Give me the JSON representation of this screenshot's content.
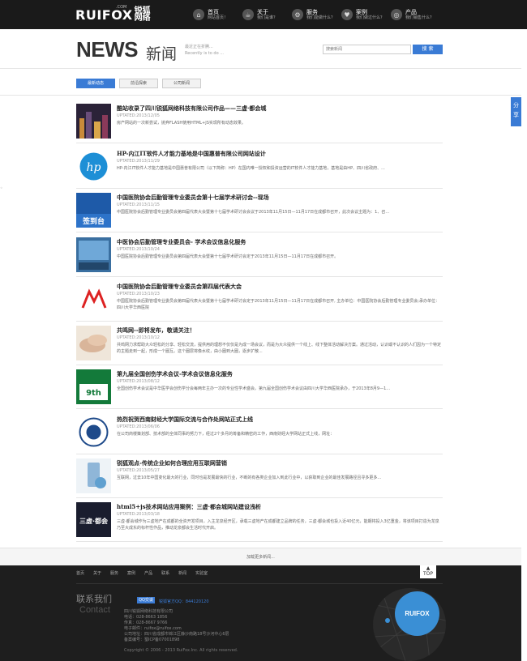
{
  "header": {
    "logo_text": "RUIFOX",
    "logo_com": ".COM",
    "logo_cn": "锐狐网络",
    "nav": [
      {
        "title": "首页",
        "sub": "网站首页！",
        "icon": "home-icon"
      },
      {
        "title": "关于",
        "sub": "我们是谁？",
        "icon": "coffee-icon"
      },
      {
        "title": "服务",
        "sub": "我们能做什么？",
        "icon": "gear-icon"
      },
      {
        "title": "案例",
        "sub": "我们做过什么？",
        "icon": "heart-icon"
      },
      {
        "title": "产品",
        "sub": "我们销售什么？",
        "icon": "settings-icon"
      }
    ]
  },
  "page": {
    "title_en": "NEWS",
    "title_cn": "新闻",
    "sub_line1": "最近正在折腾...",
    "sub_line2": "Recently is to do ...",
    "search_placeholder": "搜索新闻",
    "search_button": "搜 索"
  },
  "tabs": [
    {
      "label": "最新动态",
      "active": true
    },
    {
      "label": "前沿探索",
      "active": false
    },
    {
      "label": "公司新闻",
      "active": false
    }
  ],
  "share_label": "分享",
  "news": [
    {
      "title": "酷站收录了四川锐狐网络科技有限公司作品——三虚·都会城",
      "date": "UPTATED:2013/12/05",
      "desc": "房产网站的一次新尝试，抛弃FLASH使用HTML+JS实现所有动态效果。",
      "thumb": "city"
    },
    {
      "title": "HP-内江IT软件人才能力基地是中国惠普有限公司网站设计",
      "date": "UPTATED:2013/11/29",
      "desc": "HP-内江IT软件人才能力基地是中国惠普有限公司（以下简称：HP）在国内唯一授权和投资运营的IT软件人才能力基地，基地是由HP、四川省政府、...",
      "thumb": "hp"
    },
    {
      "title": "中国医院协会后勤管理专业委员会第十七届学术研讨会--现场",
      "date": "UPTATED:2013/11/15",
      "desc": "中国医院协会后勤管理专业委员会第四届代表大会暨第十七届学术研讨会会议于2013年11月15日—11月17日在成都市召开，此次会议主题为：1、召...",
      "thumb": "sign"
    },
    {
      "title": "中医协会后勤管理专业委员会- 学术会议信息化服务",
      "date": "UPTATED:2013/10/24",
      "desc": "中国医院协会后勤管理专业委员会第四届代表大会暨第十七届学术研讨会定于2013年11月15日—11月17日在成都市召开。",
      "thumb": "screen"
    },
    {
      "title": "中国医院协会后勤管理专业委员会第四届代表大会",
      "date": "UPTATED:2013/10/23",
      "desc": "中国医院协会后勤管理专业委员会第四届代表大会暨第十七届学术研讨会定于2013年11月15日—11月17日在成都市召开, 主办单位：中国医院协会后勤管理专业委员会;承办单位：四川大学华西医院",
      "thumb": "logo-red"
    },
    {
      "title": "共鸣网--即将发布，敬请关注！",
      "date": "UPTATED:2013/10/12",
      "desc": "共鸣网力求帮助大众轻松的分享、轻松交流，提供用的理想不仅仅是为成一场会议，而是为大众提供一个线上、线下整体活动解决方案。通过活动，认识或不认识的人们因为一个特定的主题走到一起，形成一个圈互。这个圈层将像水纹，由小圈到大圈，逐步扩散...",
      "thumb": "hands"
    },
    {
      "title": "第九届全国创伤学术会议-学术会议信息化服务",
      "date": "UPTATED:2013/08/12",
      "desc": "全国创伤学术会议是中华医学会创伤学分会每两年主办一次的专业性学术盛会。第九届全国创伤学术会议由四川大学华西医院承办，于2013年8月9—1...",
      "thumb": "green"
    },
    {
      "title": "热烈祝贺西南财经大学国际交流与合作处网站正式上线",
      "date": "UPTATED:2013/06/06",
      "desc": "在公司商楼策划部、技术部的全体同事的努力下，经过2个多月的筹备和精密的工作，西南财经大学网站正式上线，网址：",
      "thumb": "seal"
    },
    {
      "title": "锐狐观点-传统企业如何合理应用互联网营销",
      "date": "UPTATED:2013/05/27",
      "desc": "互联网，过去10年中国变化最大的行业，同时也是发展最快的行业，不断的有各类企业加入到此行业中，以获取到企业的最佳发展路径且寻多更多...",
      "thumb": "mobile"
    },
    {
      "title": "html5+js技术网站应用案例：三虚·都会城网站建设浅析",
      "date": "UPTATED:2013/03/18",
      "desc": "三虚·都会城作为三虚地产在成都的全资开发项目，入主龙泉经开区，承载三虚地产在成都建立品牌的任务，三虚·都会城也投入近40亿元，能期将投入3亿重金，将该项目打造为龙泉乃至大成东的标杆性作品，推动龙泉都会生活时代开启。",
      "thumb": "dark"
    }
  ],
  "load_more": "加载更多新闻...",
  "footer": {
    "nav": [
      "首页",
      "关于",
      "服务",
      "案例",
      "产品",
      "联系",
      "新闻",
      "实验室"
    ],
    "totop": "TOP",
    "contact_cn": "联系我们",
    "contact_en": "Contact",
    "qq_badge": "QQ交谈",
    "qq_text": "锐狐官方QQ：844120120",
    "info": [
      "四川锐狐网络科技有限公司",
      "电话：028-8663 1856",
      "传真：028-8667 9766",
      "电子邮件：ruifox@ruifox.com",
      "公司地址：四川省成都市锦江区静沙南路18号沙河中心6层",
      "备案编号：蜀ICP备07001898"
    ],
    "copyright": "Copyright © 2006 - 2013 RuiFox.Inc. All rights reserved.",
    "map_badge": "RUIFOX"
  }
}
